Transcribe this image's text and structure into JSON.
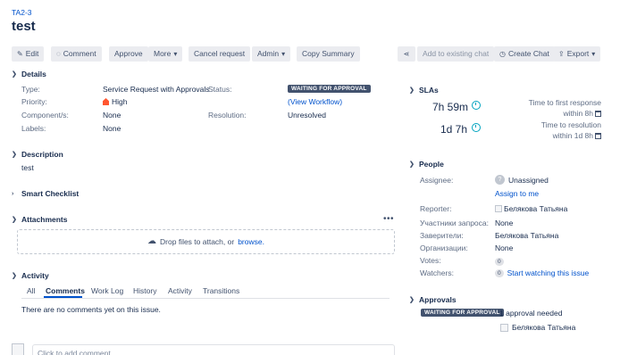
{
  "breadcrumb": "TA2-3",
  "title": "test",
  "toolbar": {
    "edit": "Edit",
    "comment": "Comment",
    "approve": "Approve",
    "more": "More",
    "cancel_request": "Cancel request",
    "admin": "Admin",
    "copy_summary": "Copy Summary",
    "add_to_chat": "Add to existing chat",
    "create_chat": "Create Chat",
    "export": "Export"
  },
  "details": {
    "heading": "Details",
    "type_label": "Type:",
    "type_value": "Service Request with Approvals",
    "priority_label": "Priority:",
    "priority_value": "High",
    "components_label": "Component/s:",
    "components_value": "None",
    "labels_label": "Labels:",
    "labels_value": "None",
    "status_label": "Status:",
    "status_value": "WAITING FOR APPROVAL",
    "workflow_link": "(View Workflow)",
    "resolution_label": "Resolution:",
    "resolution_value": "Unresolved"
  },
  "description": {
    "heading": "Description",
    "text": "test"
  },
  "smart_checklist": {
    "heading": "Smart Checklist"
  },
  "attachments": {
    "heading": "Attachments",
    "more": "•••",
    "drop_text": "Drop files to attach, or",
    "browse": "browse."
  },
  "activity": {
    "heading": "Activity",
    "tabs": [
      "All",
      "Comments",
      "Work Log",
      "History",
      "Activity",
      "Transitions"
    ],
    "empty": "There are no comments yet on this issue.",
    "comment_placeholder": "Click to add comment"
  },
  "slas": {
    "heading": "SLAs",
    "items": [
      {
        "time": "7h 59m",
        "label": "Time to first response",
        "due": "within 8h"
      },
      {
        "time": "1d 7h",
        "label": "Time to resolution",
        "due": "within 1d 8h"
      }
    ]
  },
  "people": {
    "heading": "People",
    "assignee_label": "Assignee:",
    "assignee_value": "Unassigned",
    "assign_to_me": "Assign to me",
    "reporter_label": "Reporter:",
    "reporter_value": "Белякова Татьяна",
    "participants_label": "Участники запроса:",
    "participants_value": "None",
    "approvers_label": "Заверители:",
    "approvers_value": "Белякова Татьяна",
    "orgs_label": "Организации:",
    "orgs_value": "None",
    "votes_label": "Votes:",
    "votes_value": "0",
    "watchers_label": "Watchers:",
    "watchers_value": "0",
    "start_watching": "Start watching this issue"
  },
  "approvals": {
    "heading": "Approvals",
    "status": "WAITING FOR APPROVAL",
    "needed": "1 approval needed",
    "approver": "Белякова Татьяна"
  },
  "colors": {
    "link": "#0052cc",
    "badge": "#42526e",
    "priority_high": "#ff5630",
    "clock": "#00a3bf"
  }
}
